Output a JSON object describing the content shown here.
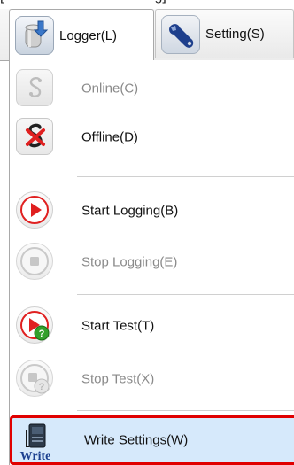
{
  "window": {
    "top_fragment": "[",
    "top_fragment_tail": "g]"
  },
  "tabs": {
    "logger": {
      "label": "Logger(L)",
      "icon": "logger-icon",
      "active": true
    },
    "setting": {
      "label": "Setting(S)",
      "icon": "wrench-icon",
      "active": false
    }
  },
  "menu": {
    "items": [
      {
        "label": "Online(C)",
        "icon": "online-icon",
        "enabled": false
      },
      {
        "label": "Offline(D)",
        "icon": "offline-icon",
        "enabled": true
      },
      {
        "label": "Start Logging(B)",
        "icon": "start-logging-icon",
        "enabled": true
      },
      {
        "label": "Stop Logging(E)",
        "icon": "stop-logging-icon",
        "enabled": false
      },
      {
        "label": "Start Test(T)",
        "icon": "start-test-icon",
        "enabled": true
      },
      {
        "label": "Stop Test(X)",
        "icon": "stop-test-icon",
        "enabled": false
      },
      {
        "label": "Write Settings(W)",
        "icon": "write-settings-icon",
        "enabled": true,
        "highlighted": true,
        "icon_caption": "Write"
      }
    ]
  },
  "colors": {
    "highlight_bg": "#d6e9fb",
    "highlight_border": "#e00000",
    "enabled_text": "#111111",
    "disabled_text": "#8a8a8a",
    "accent_red": "#e02020"
  }
}
